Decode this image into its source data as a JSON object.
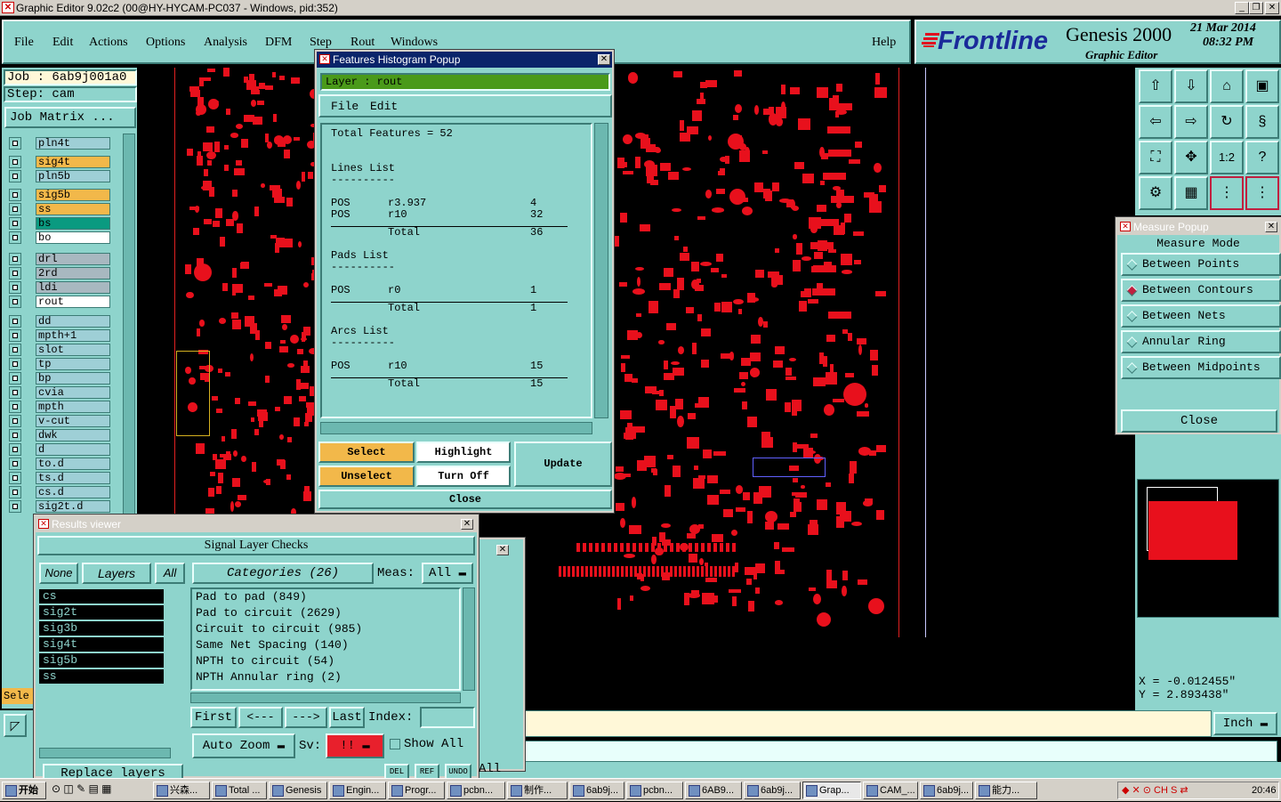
{
  "window": {
    "title": "Graphic Editor 9.02c2 (00@HY-HYCAM-PC037 - Windows, pid:352)"
  },
  "menu": [
    "File",
    "Edit",
    "Actions",
    "Options",
    "Analysis",
    "DFM",
    "Step",
    "Rout",
    "Windows"
  ],
  "help": "Help",
  "brand": {
    "logo": "Frontline",
    "product": "Genesis 2000",
    "subtitle": "Graphic Editor",
    "date": "21 Mar 2014",
    "time": "08:32 PM"
  },
  "job": {
    "job_label": "Job : 6ab9j001a0",
    "step_label": "Step: cam",
    "matrix_button": "Job Matrix ..."
  },
  "layers": [
    {
      "name": "pln4t",
      "color": "#9ecfd6"
    },
    {
      "name": "sig4t",
      "color": "#f2b84a"
    },
    {
      "name": "pln5b",
      "color": "#9ecfd6"
    },
    {
      "name": "sig5b",
      "color": "#f2b84a"
    },
    {
      "name": "ss",
      "color": "#f2b84a"
    },
    {
      "name": "bs",
      "color": "#0a9a80"
    },
    {
      "name": "bo",
      "color": "#ffffff"
    },
    {
      "name": "drl",
      "color": "#a8b8c0"
    },
    {
      "name": "2rd",
      "color": "#a8b8c0"
    },
    {
      "name": "ldi",
      "color": "#a8b8c0"
    },
    {
      "name": "rout",
      "color": "#ffffff"
    },
    {
      "name": "dd",
      "color": "#9ecfd6"
    },
    {
      "name": "mpth+1",
      "color": "#9ecfd6"
    },
    {
      "name": "slot",
      "color": "#9ecfd6"
    },
    {
      "name": "tp",
      "color": "#9ecfd6"
    },
    {
      "name": "bp",
      "color": "#9ecfd6"
    },
    {
      "name": "cvia",
      "color": "#9ecfd6"
    },
    {
      "name": "mpth",
      "color": "#9ecfd6"
    },
    {
      "name": "v-cut",
      "color": "#9ecfd6"
    },
    {
      "name": "dwk",
      "color": "#9ecfd6"
    },
    {
      "name": "d",
      "color": "#9ecfd6"
    },
    {
      "name": "to.d",
      "color": "#9ecfd6"
    },
    {
      "name": "ts.d",
      "color": "#9ecfd6"
    },
    {
      "name": "cs.d",
      "color": "#9ecfd6"
    },
    {
      "name": "sig2t.d",
      "color": "#9ecfd6"
    }
  ],
  "left_bottom_label": "Sele",
  "histogram": {
    "title": "Features Histogram Popup",
    "layer_label": "Layer :  rout",
    "menu_file": "File",
    "menu_edit": "Edit",
    "total": "Total Features = 52",
    "lines_head": "Lines List",
    "lines": [
      {
        "pol": "POS",
        "sym": "r3.937",
        "count": "4"
      },
      {
        "pol": "POS",
        "sym": "r10",
        "count": "32"
      }
    ],
    "lines_total": "36",
    "pads_head": "Pads List",
    "pads": [
      {
        "pol": "POS",
        "sym": "r0",
        "count": "1"
      }
    ],
    "pads_total": "1",
    "arcs_head": "Arcs List",
    "arcs": [
      {
        "pol": "POS",
        "sym": "r10",
        "count": "15"
      }
    ],
    "arcs_total": "15",
    "total_word": "Total",
    "dashes": "----------",
    "btn_select": "Select",
    "btn_highlight": "Highlight",
    "btn_unselect": "Unselect",
    "btn_turnoff": "Turn Off",
    "btn_update": "Update",
    "btn_close": "Close"
  },
  "measure": {
    "title": "Measure Popup",
    "mode": "Measure Mode",
    "options": [
      {
        "label": "Between Points",
        "on": false
      },
      {
        "label": "Between Contours",
        "on": true
      },
      {
        "label": "Between Nets",
        "on": false
      },
      {
        "label": "Annular Ring",
        "on": false
      },
      {
        "label": "Between Midpoints",
        "on": false
      }
    ],
    "close": "Close"
  },
  "coords": {
    "x": "X = -0.012455\"",
    "y": "Y = 2.893438\""
  },
  "units": "Inch",
  "results": {
    "title": "Results viewer",
    "header": "Signal Layer Checks",
    "none": "None",
    "layers": "Layers",
    "all": "All",
    "categories": "Categories (26)",
    "meas_label": "Meas:",
    "meas_value": "All",
    "layer_list": [
      "cs",
      "sig2t",
      "sig3b",
      "sig4t",
      "sig5b",
      "ss"
    ],
    "cat_list": [
      "Pad to pad (849)",
      "Pad to circuit (2629)",
      "Circuit to circuit (985)",
      "Same Net Spacing (140)",
      "NPTH to circuit (54)",
      "NPTH Annular ring (2)"
    ],
    "first": "First",
    "prev": "<---",
    "next": "--->",
    "last": "Last",
    "index_label": "Index:",
    "auto_zoom": "Auto Zoom",
    "sv": "Sv:",
    "sv_value": "!!",
    "show_all": "Show All",
    "replace": "Replace layers",
    "del": "DEL",
    "ref": "REF",
    "undo": "UNDO",
    "all2": "All"
  },
  "taskbar": {
    "start": "开始",
    "tasks": [
      "兴森...",
      "Total ...",
      "Genesis",
      "Engin...",
      "Progr...",
      "pcbn...",
      "制作...",
      "6ab9j...",
      "pcbn...",
      "6AB9...",
      "6ab9j...",
      "Grap...",
      "CAM_...",
      "6ab9j...",
      "能力..."
    ],
    "clock": "20:46"
  }
}
